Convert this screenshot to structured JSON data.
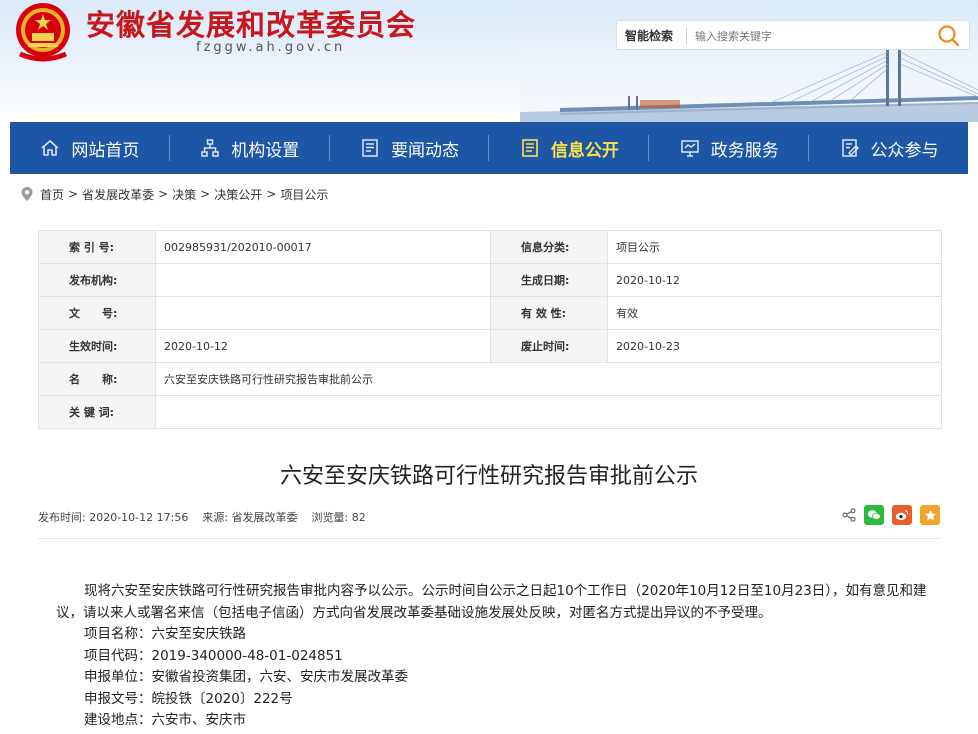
{
  "header": {
    "site_title": "安徽省发展和改革委员会",
    "site_domain": "fzggw.ah.gov.cn",
    "search_label": "智能检索",
    "search_placeholder": "输入搜索关键字"
  },
  "nav": {
    "items": [
      {
        "label": "网站首页",
        "icon": "home-icon"
      },
      {
        "label": "机构设置",
        "icon": "org-chart-icon"
      },
      {
        "label": "要闻动态",
        "icon": "news-icon"
      },
      {
        "label": "信息公开",
        "icon": "document-icon",
        "active": true
      },
      {
        "label": "政务服务",
        "icon": "monitor-icon"
      },
      {
        "label": "公众参与",
        "icon": "edit-icon"
      }
    ]
  },
  "breadcrumb": [
    "首页",
    "省发展改革委",
    "决策",
    "决策公开",
    "项目公示"
  ],
  "meta_table": {
    "index_label": "索 引 号:",
    "index_value": "002985931/202010-00017",
    "category_label": "信息分类:",
    "category_value": "项目公示",
    "publisher_label": "发布机构:",
    "publisher_value": "",
    "created_label": "生成日期:",
    "created_value": "2020-10-12",
    "docno_label": "文　　号:",
    "docno_value": "",
    "validity_label": "有 效 性:",
    "validity_value": "有效",
    "effective_label": "生效时间:",
    "effective_value": "2020-10-12",
    "expire_label": "废止时间:",
    "expire_value": "2020-10-23",
    "name_label": "名　　称:",
    "name_value": "六安至安庆铁路可行性研究报告审批前公示",
    "keywords_label": "关 键 词:",
    "keywords_value": ""
  },
  "article": {
    "title": "六安至安庆铁路可行性研究报告审批前公示",
    "publish_time": "发布时间: 2020-10-12 17:56",
    "source": "来源: 省发展改革委",
    "views": "浏览量: 82",
    "intro": "现将六安至安庆铁路可行性研究报告审批内容予以公示。公示时间自公示之日起10个工作日（2020年10月12日至10月23日），如有意见和建议，请以来人或署名来信（包括电子信函）方式向省发展改革委基础设施发展处反映，对匿名方式提出异议的不予受理。",
    "lines": [
      "项目名称：六安至安庆铁路",
      "项目代码：2019-340000-48-01-024851",
      "申报单位：安徽省投资集团，六安、安庆市发展改革委",
      "申报文号：皖投铁〔2020〕222号",
      "建设地点：六安市、安庆市"
    ]
  },
  "colors": {
    "nav_bg": "#1d56a5",
    "title_red": "#c8161d",
    "nav_active": "#ffe14a",
    "wechat": "#2dbb3c",
    "weibo": "#ea5b2e",
    "favorite": "#f3a42c"
  }
}
